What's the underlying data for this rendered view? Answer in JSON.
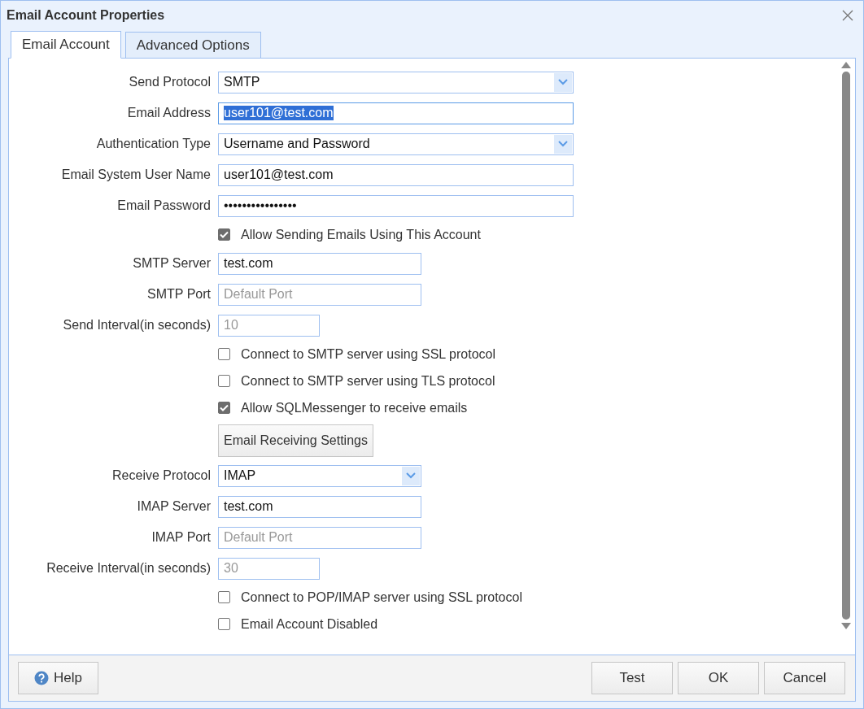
{
  "window": {
    "title": "Email Account Properties"
  },
  "tabs": [
    {
      "label": "Email Account",
      "selected": true
    },
    {
      "label": "Advanced Options",
      "selected": false
    }
  ],
  "rows": [
    {
      "kind": "select",
      "label": "Send Protocol",
      "value": "SMTP",
      "wide": true
    },
    {
      "kind": "text",
      "label": "Email Address",
      "value": "user101@test.com",
      "wide": true,
      "focused": true,
      "text_selected": true
    },
    {
      "kind": "select",
      "label": "Authentication Type",
      "value": "Username and Password",
      "wide": true
    },
    {
      "kind": "text",
      "label": "Email System User Name",
      "value": "user101@test.com",
      "wide": true
    },
    {
      "kind": "password",
      "label": "Email Password",
      "value": "••••••••••••••••",
      "wide": true
    },
    {
      "kind": "checkbox",
      "label": "Allow Sending Emails Using This Account",
      "checked": true
    },
    {
      "kind": "text",
      "label": "SMTP Server",
      "value": "test.com",
      "wide": false
    },
    {
      "kind": "text",
      "label": "SMTP Port",
      "placeholder": "Default Port",
      "wide": false
    },
    {
      "kind": "number",
      "label": "Send Interval(in seconds)",
      "value": "10",
      "disabled": true
    },
    {
      "kind": "checkbox",
      "label": "Connect to SMTP server using SSL protocol",
      "checked": false
    },
    {
      "kind": "checkbox",
      "label": "Connect to SMTP server using TLS protocol",
      "checked": false
    },
    {
      "kind": "checkbox",
      "label": "Allow SQLMessenger to receive emails",
      "checked": true
    },
    {
      "kind": "button",
      "label": "Email Receiving Settings"
    },
    {
      "kind": "select",
      "label": "Receive Protocol",
      "value": "IMAP",
      "wide": false
    },
    {
      "kind": "text",
      "label": "IMAP Server",
      "value": "test.com",
      "wide": false
    },
    {
      "kind": "text",
      "label": "IMAP Port",
      "placeholder": "Default Port",
      "wide": false
    },
    {
      "kind": "number",
      "label": "Receive Interval(in seconds)",
      "value": "30",
      "disabled": true
    },
    {
      "kind": "checkbox",
      "label": "Connect to POP/IMAP server using SSL protocol",
      "checked": false
    },
    {
      "kind": "checkbox",
      "label": "Email Account Disabled",
      "checked": false
    }
  ],
  "footer": {
    "help": "Help",
    "buttons": [
      "Test",
      "OK",
      "Cancel"
    ]
  }
}
